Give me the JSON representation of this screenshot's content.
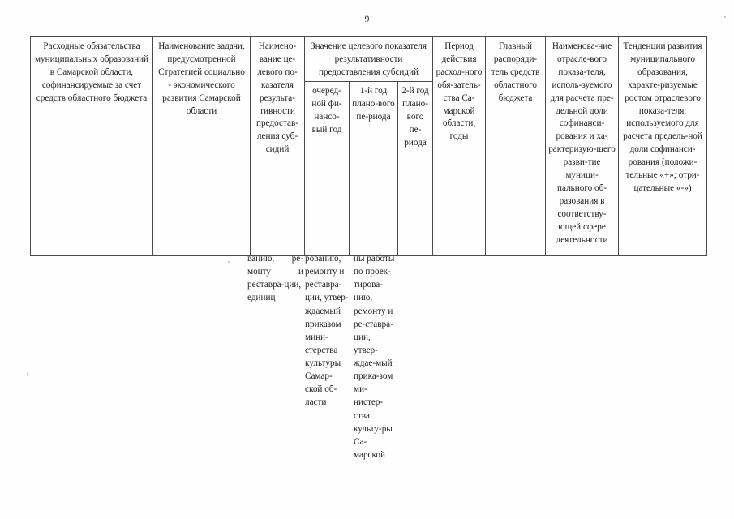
{
  "document": {
    "page_number": "9",
    "language": "ru",
    "type": "government-regulation-table",
    "page_background": "#fefefe",
    "text_color": "#1f1f1f",
    "border_color": "#4a4a4a"
  },
  "table": {
    "columns": [
      {
        "id": "col-1",
        "header": "Расходные обязательства муниципальных образований в Самарской области, софинансируемые за счет средств областного бюджета"
      },
      {
        "id": "col-2",
        "header": "Наименование задачи, предусмотренной Стратегией социально - экономического развития Самарской области"
      },
      {
        "id": "col-3",
        "header": "Наимено-вание це-левого по-казателя результа-тивности предостав-ления суб-сидий"
      },
      {
        "id": "col-group-value",
        "header": "Значение целевого показателя результативности предоставления субсидий",
        "subcolumns": [
          {
            "id": "col-4",
            "header": "очеред-ной фи-нансо-вый год"
          },
          {
            "id": "col-5",
            "header": "1-й год плано-вого пе-риода"
          },
          {
            "id": "col-6",
            "header": "2-й год плано-вого пе-риода"
          }
        ]
      },
      {
        "id": "col-7",
        "header": "Период действия расход-ного обя-затель-ства Са-марской области, годы"
      },
      {
        "id": "col-8",
        "header": "Главный распоряди-тель средств областного бюджета"
      },
      {
        "id": "col-9",
        "header": "Наименова-ние отрасле-вого показа-теля, исполь-зуемого для расчета пре-дельной доли софинанси-рования и ха-рактеризую-щего разви-тие муници-пального об-разования в соответству-ющей сфере деятельности"
      },
      {
        "id": "col-10",
        "header": "Тенденции развития муниципального образования, характе-ризуемые ростом отраслевого показа-теля, используемого для расчета предель-ной доли софинанси-рования (положи-тельные «+»; отри-цательные «-»)"
      }
    ]
  },
  "continuation": {
    "columns": [
      {
        "id": "cont-col-3",
        "text": "ванию, ре-монту и реставра-ции, единиц"
      },
      {
        "id": "cont-col-4",
        "text": "рованию, ремонту и реставра-ции, утвер-ждаемый приказом мини-стерства культуры Самар-ской об-ласти"
      },
      {
        "id": "cont-col-5",
        "text": "ны работы по проек-тирова-нию, ремонту и ре-ставра-ции, утвер-ждае-мый прика-зом ми-нистер-ства культу-ры Са-марской"
      }
    ]
  }
}
